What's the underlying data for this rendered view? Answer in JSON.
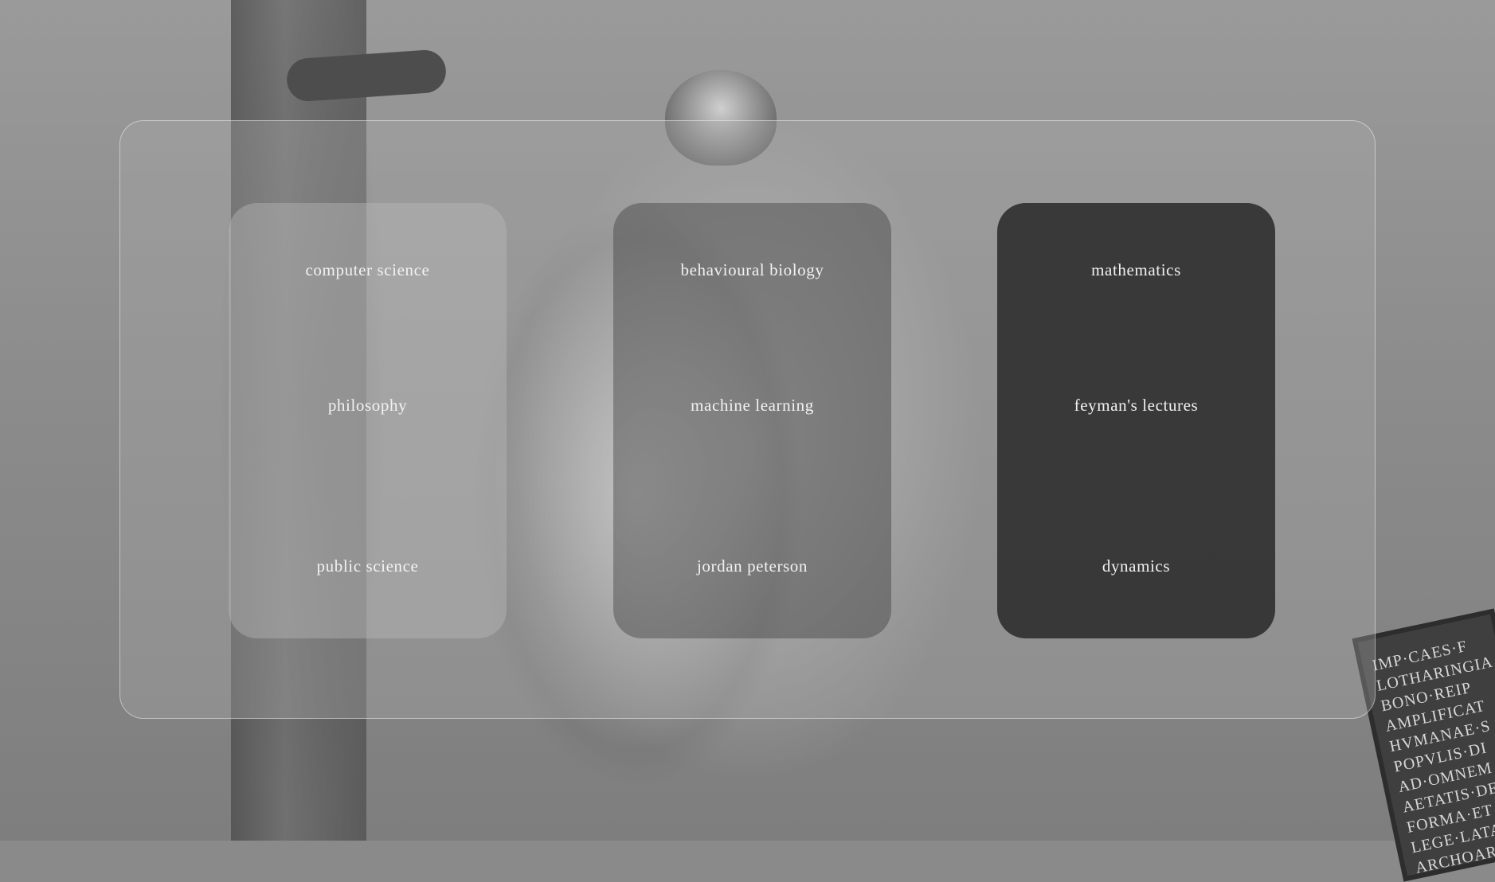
{
  "cards": [
    {
      "items": [
        "computer science",
        "philosophy",
        "public science"
      ]
    },
    {
      "items": [
        "behavioural biology",
        "machine learning",
        "jordan peterson"
      ]
    },
    {
      "items": [
        "mathematics",
        "feyman's lectures",
        "dynamics"
      ]
    }
  ],
  "background": {
    "plaque_lines": [
      "IMP·CAES·F",
      "LOTHARINGIA",
      "BONO·REIP",
      "AMPLIFICAT",
      "HVMANAE·S",
      "POPVLIS·DI",
      "AD·OMNEM",
      "AETATIS·DE",
      "FORMA·ET",
      "LEGE·LATA",
      "ARCHOARH"
    ]
  },
  "colors": {
    "panel_border": "#d9d9d9",
    "card_dark": "#343434",
    "text": "#f2f2f2"
  }
}
